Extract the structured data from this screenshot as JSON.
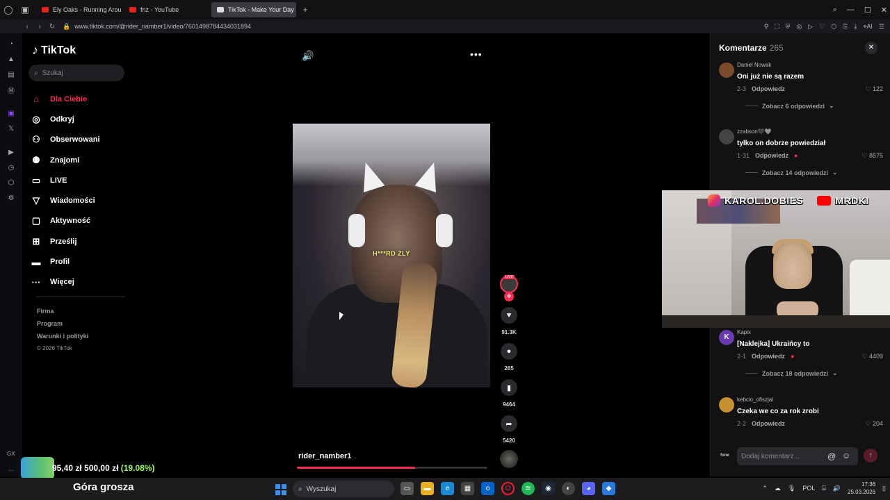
{
  "browser": {
    "tabs": [
      {
        "title": "Ely Oaks - Running Around",
        "fav_color": "#e62117"
      },
      {
        "title": "friz - YouTube",
        "fav_color": "#e62117"
      },
      {
        "title": "TikTok - Make Your Day",
        "fav_color": "#dddddd"
      }
    ],
    "url": "www.tiktok.com/@rider_namber1/video/7601498784434031894"
  },
  "tiktok": {
    "logo": "TikTok",
    "search_placeholder": "Szukaj",
    "nav": [
      {
        "label": "Dla Ciebie",
        "icon": "home-icon",
        "glyph": "⌂"
      },
      {
        "label": "Odkryj",
        "icon": "compass-icon",
        "glyph": "◎"
      },
      {
        "label": "Obserwowani",
        "icon": "following-icon",
        "glyph": "⚇"
      },
      {
        "label": "Znajomi",
        "icon": "friends-icon",
        "glyph": "⚉"
      },
      {
        "label": "LIVE",
        "icon": "live-icon",
        "glyph": "▭"
      },
      {
        "label": "Wiadomości",
        "icon": "messages-icon",
        "glyph": "▽"
      },
      {
        "label": "Aktywność",
        "icon": "activity-icon",
        "glyph": "▢"
      },
      {
        "label": "Prześlij",
        "icon": "upload-icon",
        "glyph": "⊞"
      },
      {
        "label": "Profil",
        "icon": "profile-icon",
        "glyph": "▬"
      },
      {
        "label": "Więcej",
        "icon": "more-icon",
        "glyph": "···"
      }
    ],
    "footer": [
      "Firma",
      "Program",
      "Warunki i polityki"
    ],
    "copyright": "© 2026 TikTok",
    "video": {
      "caption_text": "H***RD ZLY",
      "author": "rider_namber1",
      "progress_fraction": 0.62
    },
    "actions": {
      "live_badge": "LIVE",
      "likes": "91.3K",
      "comments": "265",
      "saves": "9464",
      "shares": "5420"
    }
  },
  "comments_panel": {
    "title": "Komentarze",
    "count": "265",
    "reply_label": "Odpowiedz",
    "items": [
      {
        "user": "Daniel Nowak",
        "text": "Oni już nie są razem",
        "date": "2-3",
        "likes": "122",
        "more": "Zobacz 6 odpowiedzi",
        "av_color": "#7a4a2a"
      },
      {
        "user": "zzabson🖤🩶",
        "text": "tylko on dobrze powiedział",
        "date": "1-31",
        "likes": "8575",
        "more": "Zobacz 14 odpowiedzi",
        "av_color": "#444444"
      },
      {
        "user": "Kapix",
        "text": "[Naklejka] Ukraińcy to",
        "date": "2-1",
        "likes": "4409",
        "more": "Zobacz 18 odpowiedzi",
        "av_color": "#6a3ab0",
        "initial": "K"
      },
      {
        "user": "kebcio_ofiszjal",
        "text": "Czeka we co za rok zrobi",
        "date": "2-2",
        "likes": "204",
        "more": "",
        "av_color": "#c89030"
      }
    ],
    "input_placeholder": "Dodaj komentarz..."
  },
  "webcam": {
    "instagram_handle": "KAROL.DOBIES",
    "youtube_handle": "MRDKI"
  },
  "stream_overlay": {
    "gx_label": "GX",
    "goal_current": "95,40 zł",
    "goal_target": "500,00 zł",
    "goal_percent": "(19.08%)",
    "title": "Góra grosza"
  },
  "taskbar": {
    "search_placeholder": "Wyszukaj",
    "lang": "POL",
    "time": "17:36",
    "date": "25.03.2026"
  }
}
